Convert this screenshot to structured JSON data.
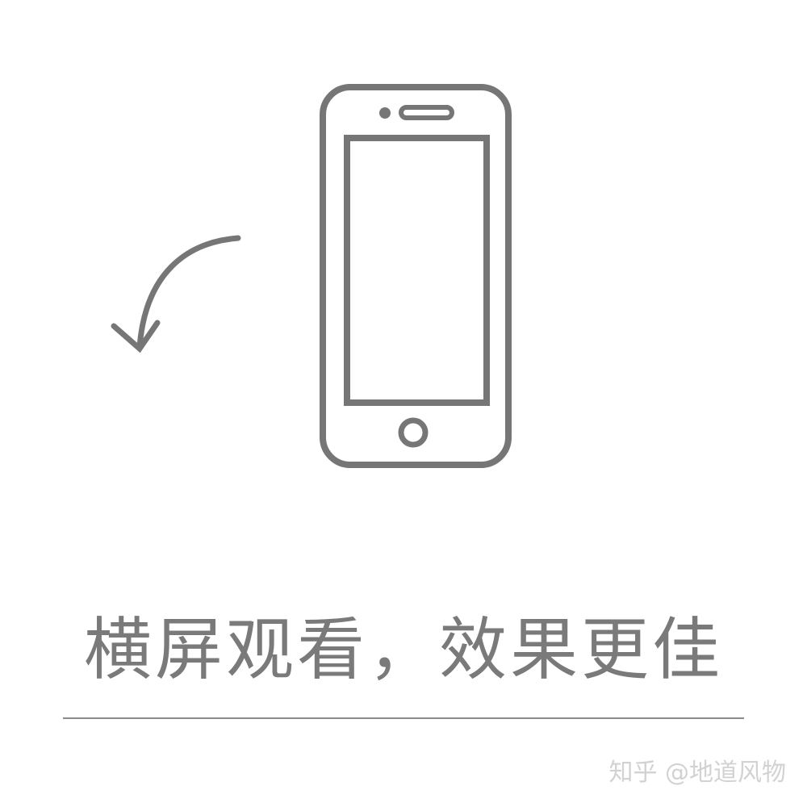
{
  "caption": "横屏观看，效果更佳",
  "watermark": "知乎 @地道风物",
  "icons": {
    "phone": "smartphone-outline-icon",
    "arrow": "rotate-arrow-icon"
  },
  "colors": {
    "stroke": "#767676",
    "caption": "#7a7a7a",
    "background": "#ffffff",
    "watermark": "#d2d2d2"
  }
}
